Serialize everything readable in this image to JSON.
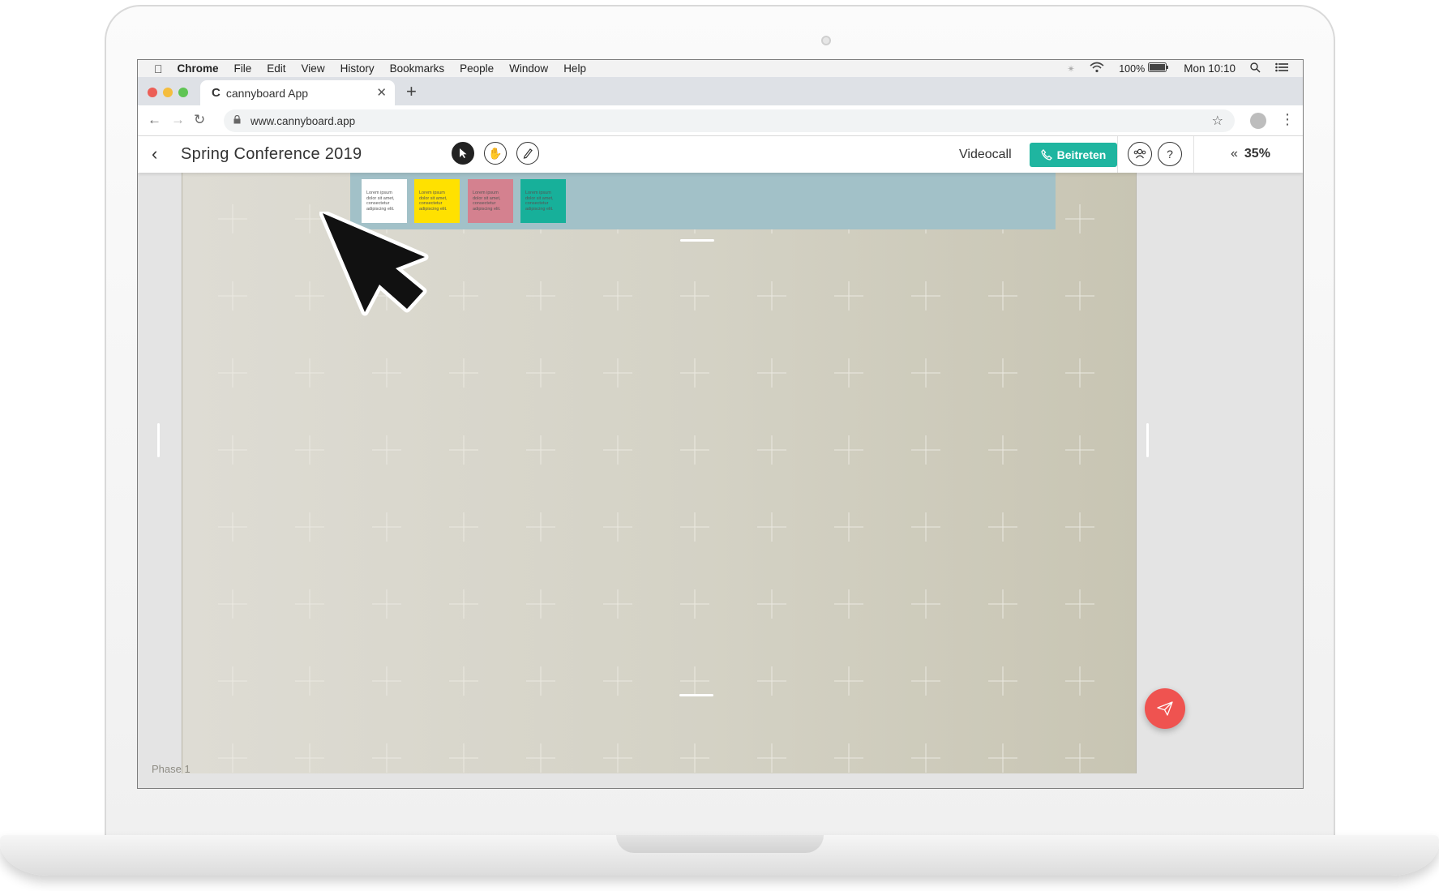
{
  "menubar": {
    "app": "Chrome",
    "items": [
      "File",
      "Edit",
      "View",
      "History",
      "Bookmarks",
      "People",
      "Window",
      "Help"
    ],
    "battery": "100%",
    "clock": "Mon 10:10"
  },
  "browser": {
    "tab_title": "cannyboard App",
    "tab_favicon": "C",
    "url": "www.cannyboard.app"
  },
  "app": {
    "board_title": "Spring Conference 2019",
    "videocall_label": "Videocall",
    "join_label": "Beitreten",
    "help_label": "?",
    "zoom_label": "35%",
    "phase_label": "Phase 1",
    "accent_color": "#1fb5a0",
    "fab_color": "#ef5350"
  },
  "notes": [
    {
      "text": "Lorem ipsum dolor sit amet, consectetur adipiscing elit.",
      "color": "#ffffff"
    },
    {
      "text": "Lorem ipsum dolor sit amet, consectetur adipiscing elit.",
      "color": "#ffe100"
    },
    {
      "text": "Lorem ipsum dolor sit amet, consectetur adipiscing elit.",
      "color": "#d4818f"
    },
    {
      "text": "Lorem ipsum dolor sit amet, consectetur adipiscing elit.",
      "color": "#17b09a"
    }
  ]
}
